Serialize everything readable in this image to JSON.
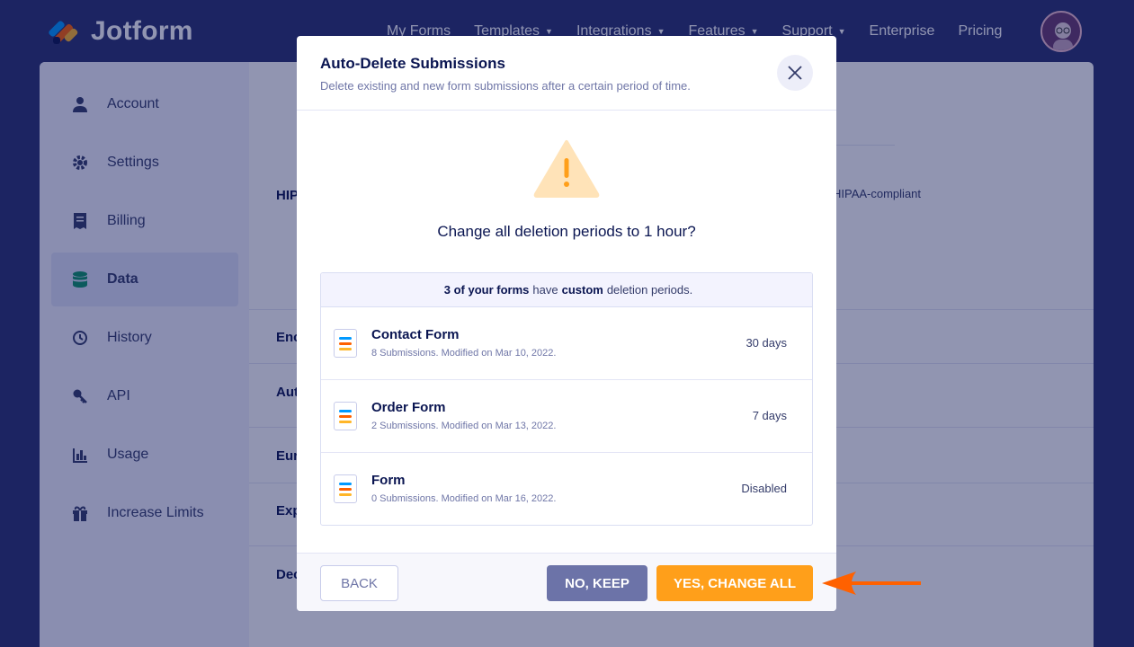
{
  "brand": {
    "name": "Jotform"
  },
  "nav": {
    "items": [
      {
        "label": "My Forms",
        "dropdown": false
      },
      {
        "label": "Templates",
        "dropdown": true
      },
      {
        "label": "Integrations",
        "dropdown": true
      },
      {
        "label": "Features",
        "dropdown": true
      },
      {
        "label": "Support",
        "dropdown": true
      },
      {
        "label": "Enterprise",
        "dropdown": false
      },
      {
        "label": "Pricing",
        "dropdown": false
      }
    ]
  },
  "sidebar": {
    "items": [
      {
        "label": "Account",
        "icon": "user-icon"
      },
      {
        "label": "Settings",
        "icon": "gear-icon"
      },
      {
        "label": "Billing",
        "icon": "receipt-icon"
      },
      {
        "label": "Data",
        "icon": "database-icon",
        "active": true
      },
      {
        "label": "History",
        "icon": "history-icon"
      },
      {
        "label": "API",
        "icon": "key-icon"
      },
      {
        "label": "Usage",
        "icon": "bar-chart-icon"
      },
      {
        "label": "Increase Limits",
        "icon": "gift-icon"
      }
    ]
  },
  "background": {
    "labels": [
      "HIP",
      "Enc",
      "Aut",
      "Eur",
      "Exp",
      "Dec"
    ],
    "hipaa_text": "HIPAA-compliant"
  },
  "modal": {
    "title": "Auto-Delete Submissions",
    "subtitle": "Delete existing and new form submissions after a certain period of time.",
    "question": "Change all deletion periods to 1 hour?",
    "summary": {
      "count": "3 of your forms",
      "mid": "have",
      "word": "custom",
      "tail": "deletion periods."
    },
    "forms": [
      {
        "name": "Contact Form",
        "meta": "8 Submissions. Modified on Mar 10, 2022.",
        "period": "30 days"
      },
      {
        "name": "Order Form",
        "meta": "2 Submissions. Modified on Mar 13, 2022.",
        "period": "7 days"
      },
      {
        "name": "Form",
        "meta": "0 Submissions. Modified on Mar 16, 2022.",
        "period": "Disabled"
      }
    ],
    "buttons": {
      "back": "BACK",
      "keep": "NO, KEEP",
      "yes": "YES, CHANGE ALL"
    }
  },
  "colors": {
    "accent": "#ff9f1a",
    "navy": "#0a1551",
    "keep": "#6c73a8",
    "arrow": "#ff6100"
  }
}
